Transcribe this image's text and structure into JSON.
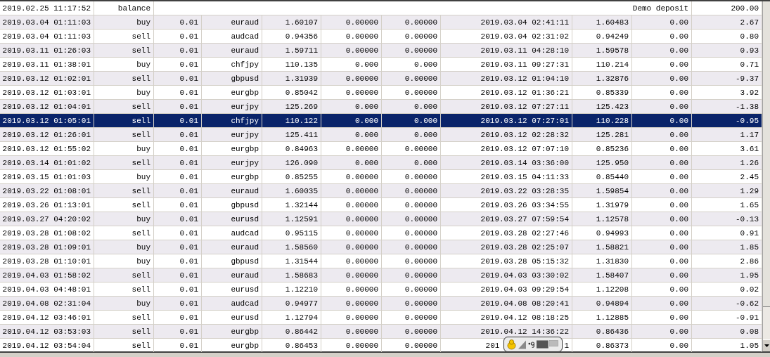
{
  "balance_row": {
    "time": "2019.02.25 11:17:52",
    "type": "balance",
    "comment": "Demo deposit",
    "profit": "200.00",
    "selected": false
  },
  "trades": [
    {
      "open_time": "2019.03.04 01:11:03",
      "type": "buy",
      "size": "0.01",
      "symbol": "euraud",
      "open_price": "1.60107",
      "sl": "0.00000",
      "tp": "0.00000",
      "close_time": "2019.03.04 02:41:11",
      "close_price": "1.60483",
      "commission": "0.00",
      "profit": "2.67",
      "selected": false
    },
    {
      "open_time": "2019.03.04 01:11:03",
      "type": "sell",
      "size": "0.01",
      "symbol": "audcad",
      "open_price": "0.94356",
      "sl": "0.00000",
      "tp": "0.00000",
      "close_time": "2019.03.04 02:31:02",
      "close_price": "0.94249",
      "commission": "0.00",
      "profit": "0.80",
      "selected": false
    },
    {
      "open_time": "2019.03.11 01:26:03",
      "type": "sell",
      "size": "0.01",
      "symbol": "euraud",
      "open_price": "1.59711",
      "sl": "0.00000",
      "tp": "0.00000",
      "close_time": "2019.03.11 04:28:10",
      "close_price": "1.59578",
      "commission": "0.00",
      "profit": "0.93",
      "selected": false
    },
    {
      "open_time": "2019.03.11 01:38:01",
      "type": "buy",
      "size": "0.01",
      "symbol": "chfjpy",
      "open_price": "110.135",
      "sl": "0.000",
      "tp": "0.000",
      "close_time": "2019.03.11 09:27:31",
      "close_price": "110.214",
      "commission": "0.00",
      "profit": "0.71",
      "selected": false
    },
    {
      "open_time": "2019.03.12 01:02:01",
      "type": "sell",
      "size": "0.01",
      "symbol": "gbpusd",
      "open_price": "1.31939",
      "sl": "0.00000",
      "tp": "0.00000",
      "close_time": "2019.03.12 01:04:10",
      "close_price": "1.32876",
      "commission": "0.00",
      "profit": "-9.37",
      "selected": false
    },
    {
      "open_time": "2019.03.12 01:03:01",
      "type": "buy",
      "size": "0.01",
      "symbol": "eurgbp",
      "open_price": "0.85042",
      "sl": "0.00000",
      "tp": "0.00000",
      "close_time": "2019.03.12 01:36:21",
      "close_price": "0.85339",
      "commission": "0.00",
      "profit": "3.92",
      "selected": false
    },
    {
      "open_time": "2019.03.12 01:04:01",
      "type": "sell",
      "size": "0.01",
      "symbol": "eurjpy",
      "open_price": "125.269",
      "sl": "0.000",
      "tp": "0.000",
      "close_time": "2019.03.12 07:27:11",
      "close_price": "125.423",
      "commission": "0.00",
      "profit": "-1.38",
      "selected": false
    },
    {
      "open_time": "2019.03.12 01:05:01",
      "type": "sell",
      "size": "0.01",
      "symbol": "chfjpy",
      "open_price": "110.122",
      "sl": "0.000",
      "tp": "0.000",
      "close_time": "2019.03.12 07:27:01",
      "close_price": "110.228",
      "commission": "0.00",
      "profit": "-0.95",
      "selected": true
    },
    {
      "open_time": "2019.03.12 01:26:01",
      "type": "sell",
      "size": "0.01",
      "symbol": "eurjpy",
      "open_price": "125.411",
      "sl": "0.000",
      "tp": "0.000",
      "close_time": "2019.03.12 02:28:32",
      "close_price": "125.281",
      "commission": "0.00",
      "profit": "1.17",
      "selected": false
    },
    {
      "open_time": "2019.03.12 01:55:02",
      "type": "buy",
      "size": "0.01",
      "symbol": "eurgbp",
      "open_price": "0.84963",
      "sl": "0.00000",
      "tp": "0.00000",
      "close_time": "2019.03.12 07:07:10",
      "close_price": "0.85236",
      "commission": "0.00",
      "profit": "3.61",
      "selected": false
    },
    {
      "open_time": "2019.03.14 01:01:02",
      "type": "sell",
      "size": "0.01",
      "symbol": "eurjpy",
      "open_price": "126.090",
      "sl": "0.000",
      "tp": "0.000",
      "close_time": "2019.03.14 03:36:00",
      "close_price": "125.950",
      "commission": "0.00",
      "profit": "1.26",
      "selected": false
    },
    {
      "open_time": "2019.03.15 01:01:03",
      "type": "buy",
      "size": "0.01",
      "symbol": "eurgbp",
      "open_price": "0.85255",
      "sl": "0.00000",
      "tp": "0.00000",
      "close_time": "2019.03.15 04:11:33",
      "close_price": "0.85440",
      "commission": "0.00",
      "profit": "2.45",
      "selected": false
    },
    {
      "open_time": "2019.03.22 01:08:01",
      "type": "sell",
      "size": "0.01",
      "symbol": "euraud",
      "open_price": "1.60035",
      "sl": "0.00000",
      "tp": "0.00000",
      "close_time": "2019.03.22 03:28:35",
      "close_price": "1.59854",
      "commission": "0.00",
      "profit": "1.29",
      "selected": false
    },
    {
      "open_time": "2019.03.26 01:13:01",
      "type": "sell",
      "size": "0.01",
      "symbol": "gbpusd",
      "open_price": "1.32144",
      "sl": "0.00000",
      "tp": "0.00000",
      "close_time": "2019.03.26 03:34:55",
      "close_price": "1.31979",
      "commission": "0.00",
      "profit": "1.65",
      "selected": false
    },
    {
      "open_time": "2019.03.27 04:20:02",
      "type": "buy",
      "size": "0.01",
      "symbol": "eurusd",
      "open_price": "1.12591",
      "sl": "0.00000",
      "tp": "0.00000",
      "close_time": "2019.03.27 07:59:54",
      "close_price": "1.12578",
      "commission": "0.00",
      "profit": "-0.13",
      "selected": false
    },
    {
      "open_time": "2019.03.28 01:08:02",
      "type": "sell",
      "size": "0.01",
      "symbol": "audcad",
      "open_price": "0.95115",
      "sl": "0.00000",
      "tp": "0.00000",
      "close_time": "2019.03.28 02:27:46",
      "close_price": "0.94993",
      "commission": "0.00",
      "profit": "0.91",
      "selected": false
    },
    {
      "open_time": "2019.03.28 01:09:01",
      "type": "buy",
      "size": "0.01",
      "symbol": "euraud",
      "open_price": "1.58560",
      "sl": "0.00000",
      "tp": "0.00000",
      "close_time": "2019.03.28 02:25:07",
      "close_price": "1.58821",
      "commission": "0.00",
      "profit": "1.85",
      "selected": false
    },
    {
      "open_time": "2019.03.28 01:10:01",
      "type": "buy",
      "size": "0.01",
      "symbol": "gbpusd",
      "open_price": "1.31544",
      "sl": "0.00000",
      "tp": "0.00000",
      "close_time": "2019.03.28 05:15:32",
      "close_price": "1.31830",
      "commission": "0.00",
      "profit": "2.86",
      "selected": false
    },
    {
      "open_time": "2019.04.03 01:58:02",
      "type": "sell",
      "size": "0.01",
      "symbol": "euraud",
      "open_price": "1.58683",
      "sl": "0.00000",
      "tp": "0.00000",
      "close_time": "2019.04.03 03:30:02",
      "close_price": "1.58407",
      "commission": "0.00",
      "profit": "1.95",
      "selected": false
    },
    {
      "open_time": "2019.04.03 04:48:01",
      "type": "sell",
      "size": "0.01",
      "symbol": "eurusd",
      "open_price": "1.12210",
      "sl": "0.00000",
      "tp": "0.00000",
      "close_time": "2019.04.03 09:29:54",
      "close_price": "1.12208",
      "commission": "0.00",
      "profit": "0.02",
      "selected": false
    },
    {
      "open_time": "2019.04.08 02:31:04",
      "type": "buy",
      "size": "0.01",
      "symbol": "audcad",
      "open_price": "0.94977",
      "sl": "0.00000",
      "tp": "0.00000",
      "close_time": "2019.04.08 08:20:41",
      "close_price": "0.94894",
      "commission": "0.00",
      "profit": "-0.62",
      "selected": false
    },
    {
      "open_time": "2019.04.12 03:46:01",
      "type": "sell",
      "size": "0.01",
      "symbol": "eurusd",
      "open_price": "1.12794",
      "sl": "0.00000",
      "tp": "0.00000",
      "close_time": "2019.04.12 08:18:25",
      "close_price": "1.12885",
      "commission": "0.00",
      "profit": "-0.91",
      "selected": false
    },
    {
      "open_time": "2019.04.12 03:53:03",
      "type": "sell",
      "size": "0.01",
      "symbol": "eurgbp",
      "open_price": "0.86442",
      "sl": "0.00000",
      "tp": "0.00000",
      "close_time": "2019.04.12 14:36:22",
      "close_price": "0.86436",
      "commission": "0.00",
      "profit": "0.08",
      "selected": false
    },
    {
      "open_time": "2019.04.12 03:54:04",
      "type": "sell",
      "size": "0.01",
      "symbol": "eurgbp",
      "open_price": "0.86453",
      "sl": "0.00000",
      "tp": "0.00000",
      "close_time_parts": [
        "201",
        "1"
      ],
      "close_price": "0.86373",
      "commission": "0.00",
      "profit": "1.05",
      "selected": false
    }
  ]
}
